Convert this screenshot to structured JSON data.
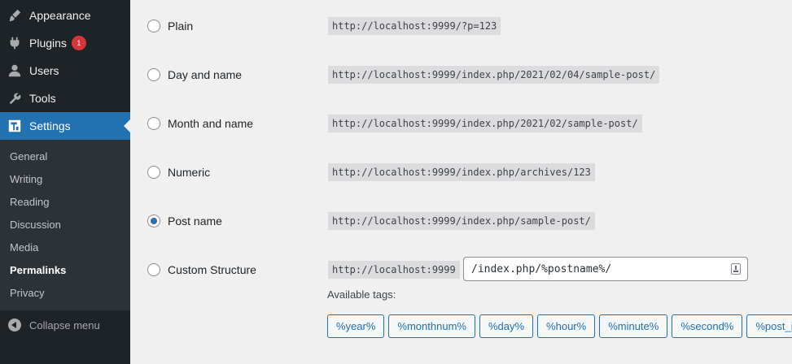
{
  "sidebar": {
    "menu": [
      {
        "label": "Appearance",
        "icon": "paintbrush-icon"
      },
      {
        "label": "Plugins",
        "icon": "plugin-icon",
        "badge": "1"
      },
      {
        "label": "Users",
        "icon": "user-icon"
      },
      {
        "label": "Tools",
        "icon": "wrench-icon"
      },
      {
        "label": "Settings",
        "icon": "settings-icon",
        "active": true
      }
    ],
    "submenu": [
      "General",
      "Writing",
      "Reading",
      "Discussion",
      "Media",
      "Permalinks",
      "Privacy"
    ],
    "current_submenu": "Permalinks",
    "collapse_label": "Collapse menu"
  },
  "permalinks": {
    "options": [
      {
        "label": "Plain",
        "example": "http://localhost:9999/?p=123",
        "checked": false
      },
      {
        "label": "Day and name",
        "example": "http://localhost:9999/index.php/2021/02/04/sample-post/",
        "checked": false
      },
      {
        "label": "Month and name",
        "example": "http://localhost:9999/index.php/2021/02/sample-post/",
        "checked": false
      },
      {
        "label": "Numeric",
        "example": "http://localhost:9999/index.php/archives/123",
        "checked": false
      },
      {
        "label": "Post name",
        "example": "http://localhost:9999/index.php/sample-post/",
        "checked": true
      }
    ],
    "custom": {
      "label": "Custom Structure",
      "prefix": "http://localhost:9999",
      "value": "/index.php/%postname%/"
    },
    "available_tags_label": "Available tags:",
    "tags": [
      "%year%",
      "%monthnum%",
      "%day%",
      "%hour%",
      "%minute%",
      "%second%",
      "%post_id%"
    ]
  },
  "colors": {
    "accent": "#2271b1",
    "sidebar_bg": "#1d2327",
    "submenu_bg": "#2c3338",
    "badge": "#d63638"
  }
}
